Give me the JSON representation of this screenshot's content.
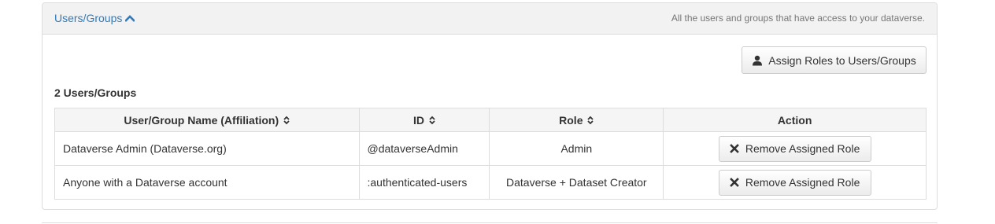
{
  "panel": {
    "toggle_label": "Users/Groups",
    "help_text": "All the users and groups that have access to your dataverse."
  },
  "assign_button": {
    "label": "Assign Roles to Users/Groups",
    "icon": "user-icon"
  },
  "count_label": "2 Users/Groups",
  "table": {
    "headers": [
      {
        "label": "User/Group Name (Affiliation)",
        "sortable": true
      },
      {
        "label": "ID",
        "sortable": true
      },
      {
        "label": "Role",
        "sortable": true
      },
      {
        "label": "Action",
        "sortable": false
      }
    ],
    "rows": [
      {
        "name": "Dataverse Admin (Dataverse.org)",
        "id": "@dataverseAdmin",
        "role": "Admin",
        "action": "Remove Assigned Role"
      },
      {
        "name": "Anyone with a Dataverse account",
        "id": ":authenticated-users",
        "role": "Dataverse + Dataset Creator",
        "action": "Remove Assigned Role"
      }
    ]
  },
  "colors": {
    "link": "#337ab7",
    "heading_bg": "#f2f2f2",
    "border": "#dddddd"
  }
}
